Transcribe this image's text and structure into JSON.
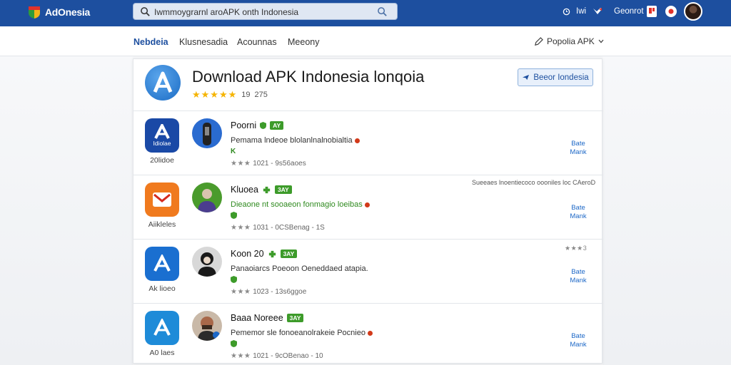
{
  "app": {
    "brand": "AdOnesia"
  },
  "search": {
    "value": "Iwmmoygrarnl aroAPK onth Indonesia"
  },
  "topbar": {
    "label_1": "Iwi",
    "label_2": "Geonrot"
  },
  "nav": {
    "items": [
      "Nebdeia",
      "Klusnesadia",
      "Acounnas",
      "Meeony"
    ],
    "active_index": 0,
    "right_label": "Popolia APK"
  },
  "hero": {
    "title": "Download APK Indonesia lonqoia",
    "stars": "★★★★★",
    "rating": "19",
    "count": "275",
    "button_label": "Beeor Iondesia"
  },
  "apps": [
    {
      "name": "Poorni",
      "badge": "AY",
      "description": "Pemama lndeoe blolanlnalnobialtia",
      "mark": "K",
      "stars": "★★★",
      "meta": "1021 - 9s56aoes",
      "caption": "20lidoe",
      "icon_label": "Idiolae",
      "icon_color": "#1a49a6",
      "action": [
        "Bate",
        "Mank"
      ]
    },
    {
      "name": "Kluoea",
      "badge": "3AY",
      "description": "Dieaone nt sooaeon fonmagio loeibas",
      "mark": "",
      "stars": "★★★",
      "meta": "1031 - 0CSBenag - 1S",
      "caption": "Aiikleles",
      "icon_label": "",
      "icon_color": "#f07a1e",
      "note": "Sueeaes lnoentiecoco oooniles loc CAeroD",
      "action": [
        "Bate",
        "Mank"
      ]
    },
    {
      "name": "Koon 20",
      "badge": "3AY",
      "description": "Panaoiarcs Poeoon Oeneddaed atapia.",
      "mark": "",
      "stars": "★★★",
      "meta": "1023 - 13s6ggoe",
      "caption": "Ak lioeo",
      "icon_label": "",
      "icon_color": "#1a6fd0",
      "row_rating": "★★★3",
      "action": [
        "Bate",
        "Mank"
      ]
    },
    {
      "name": "Baaa Noreee",
      "badge": "3AY",
      "description": "Pememor sle fonoeanolrakeie Pocnieo",
      "mark": "",
      "stars": "★★★",
      "meta": "1021 - 9cOBenao - 10",
      "caption": "A0 laes",
      "icon_label": "",
      "icon_color": "#1e8bd8",
      "action": [
        "Bate",
        "Mank"
      ]
    }
  ]
}
